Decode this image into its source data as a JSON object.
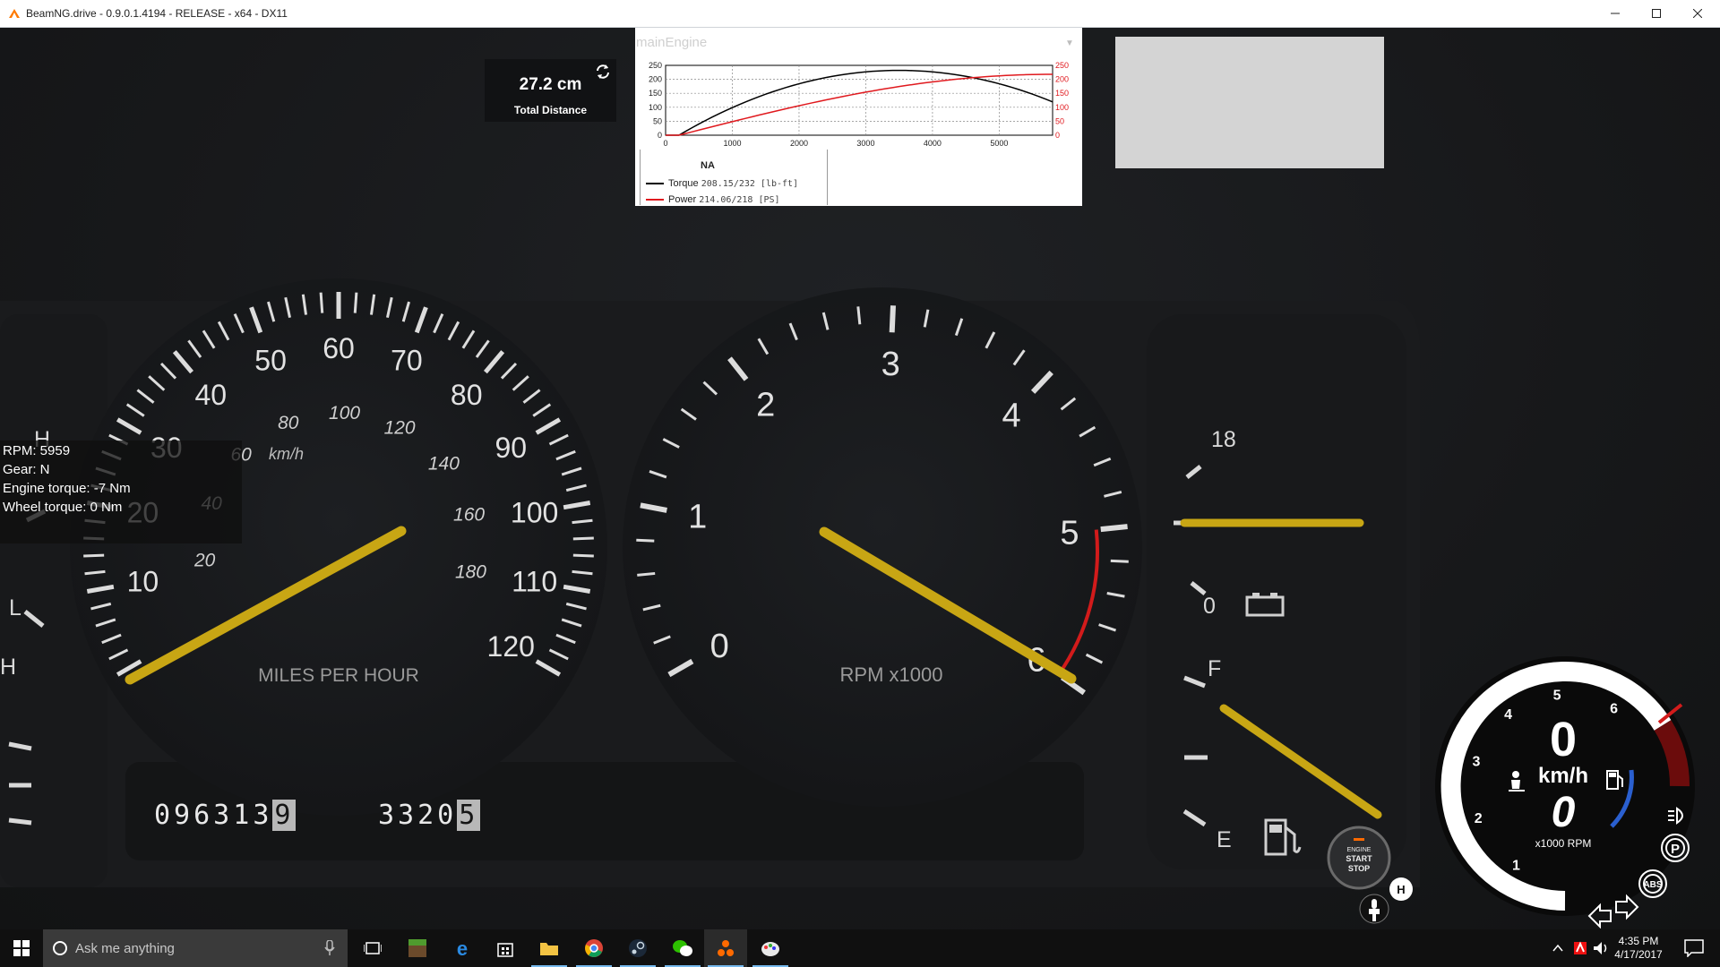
{
  "window": {
    "title": "BeamNG.drive - 0.9.0.1.4194 - RELEASE - x64 - DX11",
    "icon": "beamng-icon",
    "controls": [
      "minimize-icon",
      "maximize-icon",
      "close-icon"
    ]
  },
  "distance_widget": {
    "value": "27.2 cm",
    "label": "Total Distance",
    "icon": "refresh-icon"
  },
  "engine_graph": {
    "title": "mainEngine",
    "dropdown_icon": "chevron-down-icon",
    "x_ticks": [
      "0",
      "1000",
      "2000",
      "3000",
      "4000",
      "5000"
    ],
    "y_ticks_left": [
      "250",
      "200",
      "150",
      "100",
      "50",
      "0"
    ],
    "y_ticks_right": [
      "250",
      "200",
      "150",
      "100",
      "50",
      "0"
    ],
    "legend_title": "NA",
    "torque_label": "Torque",
    "torque_value": "208.15/232 [lb-ft]",
    "power_label": "Power",
    "power_value": "214.06/218 [PS]",
    "colors": {
      "torque": "#000000",
      "power": "#e0191e"
    }
  },
  "debug_info": {
    "rpm": "RPM: 5959",
    "gear": "Gear: N",
    "engine_torque": "Engine torque: -7 Nm",
    "wheel_torque": "Wheel torque: 0 Nm"
  },
  "speedometer": {
    "mph_labels": [
      "10",
      "20",
      "30",
      "40",
      "50",
      "60",
      "70",
      "80",
      "90",
      "100",
      "110",
      "120"
    ],
    "kmh_labels": [
      "20",
      "40",
      "60",
      "80",
      "100",
      "120",
      "140",
      "160",
      "180"
    ],
    "unit_small": "km/h",
    "caption": "MILES PER HOUR",
    "needle_color": "#c8a614"
  },
  "tachometer": {
    "labels": [
      "0",
      "1",
      "2",
      "3",
      "4",
      "5",
      "6"
    ],
    "caption": "RPM x1000",
    "redline_color": "#d21b1b"
  },
  "temp_gauge": {
    "top_label": "18",
    "bottom_label": "0",
    "icon": "battery-icon"
  },
  "fuel_gauge": {
    "full": "F",
    "empty": "E",
    "icon": "fuel-pump-icon"
  },
  "left_gauge": {
    "labels": [
      "H",
      "L",
      "H"
    ]
  },
  "odometer": {
    "main": "09631",
    "main_last": "3",
    "main_tenth": "9",
    "trip": "3320",
    "trip_last": "5"
  },
  "engine_button": {
    "line1": "ENGINE",
    "line2": "START",
    "line3": "STOP"
  },
  "hud": {
    "speed": "0",
    "speed_unit": "km/h",
    "rpm": "0",
    "rpm_unit": "x1000 RPM",
    "ring_labels": [
      "1",
      "2",
      "3",
      "4",
      "5",
      "6"
    ],
    "icons": [
      "seat-belt-icon",
      "fuel-icon",
      "headlight-icon",
      "parking-brake-icon",
      "abs-icon",
      "turn-left-icon",
      "turn-right-icon",
      "handbrake-icon",
      "gear-shifter-icon"
    ],
    "handbrake_letter": "H",
    "parking_letter": "P",
    "abs_text": "ABS"
  },
  "taskbar": {
    "search_placeholder": "Ask me anything",
    "apps": [
      "task-view-icon",
      "minecraft-icon",
      "edge-icon",
      "store-icon",
      "file-explorer-icon",
      "chrome-icon",
      "steam-icon",
      "wechat-icon",
      "beamng-taskbar-icon",
      "paint-icon"
    ],
    "time": "4:35 PM",
    "date": "4/17/2017"
  }
}
